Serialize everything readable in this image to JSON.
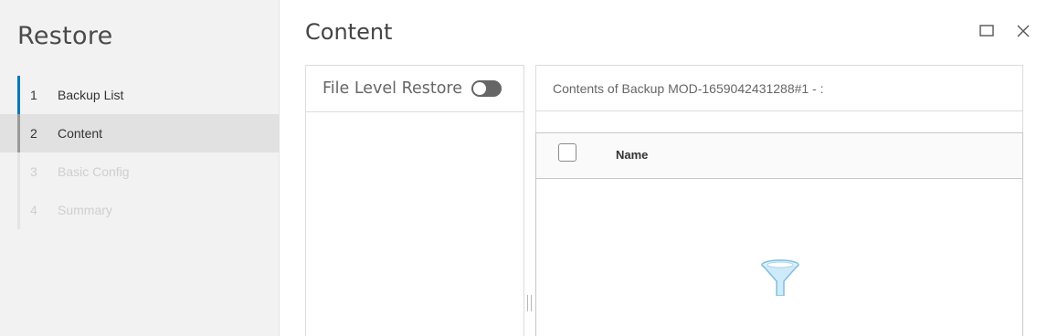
{
  "sidebar": {
    "title": "Restore",
    "steps": [
      {
        "num": "1",
        "label": "Backup List"
      },
      {
        "num": "2",
        "label": "Content"
      },
      {
        "num": "3",
        "label": "Basic Config"
      },
      {
        "num": "4",
        "label": "Summary"
      }
    ]
  },
  "main": {
    "title": "Content",
    "window_icons": [
      "maximize-icon",
      "close-icon"
    ]
  },
  "left_panel": {
    "file_level_restore_label": "File Level Restore",
    "toggle_state": "off"
  },
  "right_panel": {
    "header": "Contents of Backup MOD-1659042431288#1 - :",
    "grid": {
      "columns": [
        "Name"
      ],
      "empty_icon": "filter-funnel-icon"
    }
  },
  "colors": {
    "accent": "#0079b8",
    "sidebar_bg": "#f2f2f2",
    "active_step_bg": "#e1e1e1"
  }
}
